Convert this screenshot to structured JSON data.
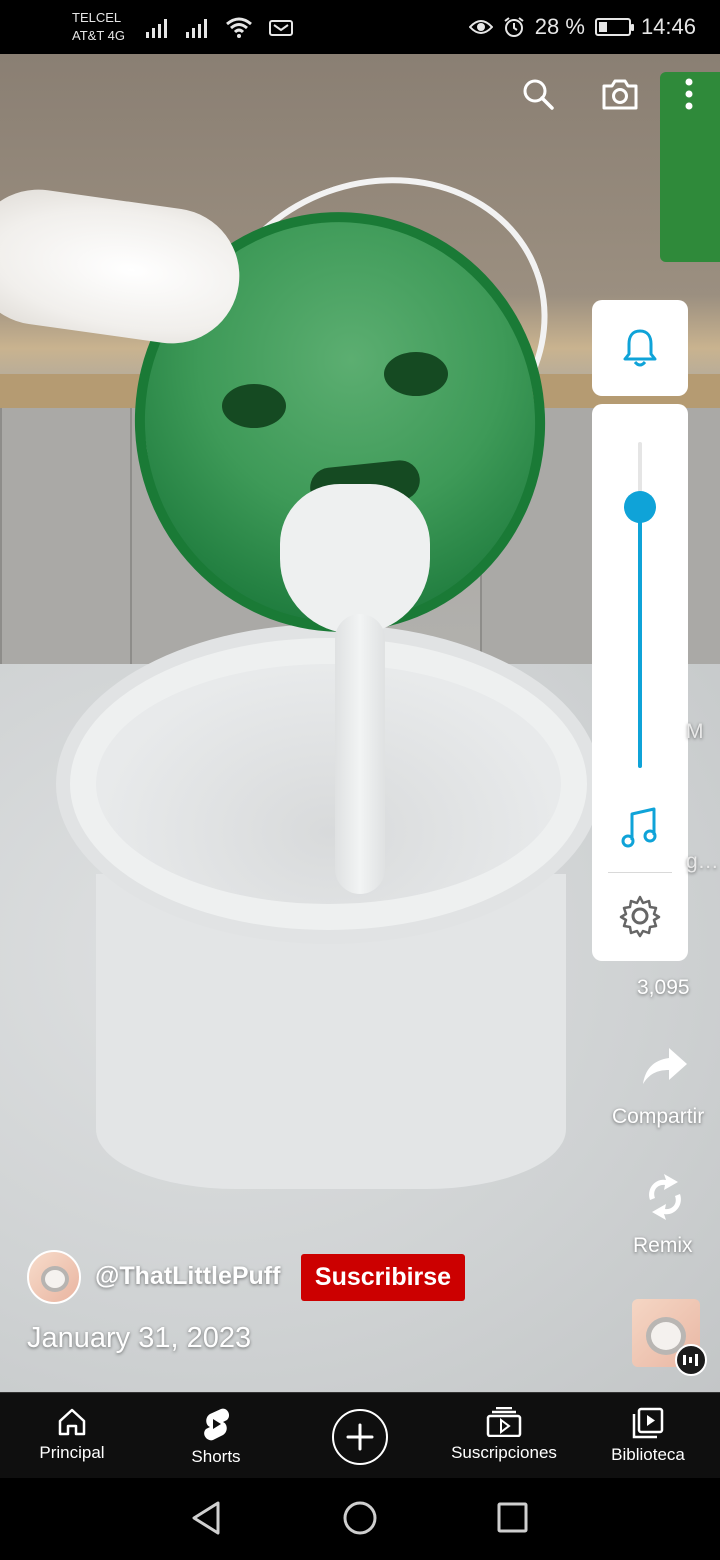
{
  "status_bar": {
    "carrier_1": "TELCEL",
    "carrier_2": "AT&T 4G",
    "battery_percent": "28 %",
    "battery_level": 0.28,
    "time": "14:46"
  },
  "video_top_icons": [
    "search-icon",
    "camera-icon",
    "more-vert-icon"
  ],
  "panel": {
    "bell_icon": "bell-icon",
    "volume_level": 0.8,
    "music_icon": "music-note-icon",
    "settings_icon": "gear-icon"
  },
  "actions": {
    "peek_text_1": "M",
    "peek_text_2": "g…",
    "likes_count": "3,095",
    "share_label": "Compartir",
    "remix_label": "Remix"
  },
  "channel": {
    "name": "@ThatLittlePuff",
    "subscribe_label": "Suscribirse",
    "date": "January 31, 2023"
  },
  "bottom_nav": {
    "items": [
      {
        "label": "Principal",
        "icon": "home-icon"
      },
      {
        "label": "Shorts",
        "icon": "shorts-icon"
      },
      {
        "label": "",
        "icon": "create-plus-icon"
      },
      {
        "label": "Suscripciones",
        "icon": "subscriptions-icon"
      },
      {
        "label": "Biblioteca",
        "icon": "library-icon"
      }
    ]
  },
  "system_nav": [
    "back-icon",
    "home-circle-icon",
    "recents-icon"
  ],
  "colors": {
    "accent_blue": "#0fa3d8",
    "subscribe_red": "#cc0000",
    "nav_background": "#0f0f0f"
  }
}
